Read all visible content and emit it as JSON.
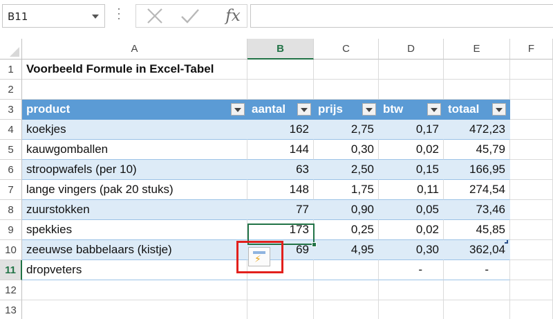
{
  "formula_bar": {
    "name_box": "B11",
    "fx_label": "fx",
    "formula": ""
  },
  "columns": [
    "A",
    "B",
    "C",
    "D",
    "E",
    "F"
  ],
  "active_column": "B",
  "rows": [
    "1",
    "2",
    "3",
    "4",
    "5",
    "6",
    "7",
    "8",
    "9",
    "10",
    "11",
    "12",
    "13"
  ],
  "active_row": "11",
  "title": "Voorbeeld Formule in Excel-Tabel",
  "table": {
    "headers": [
      "product",
      "aantal",
      "prijs",
      "btw",
      "totaal"
    ],
    "data": [
      [
        "koekjes",
        "162",
        "2,75",
        "0,17",
        "472,23"
      ],
      [
        "kauwgomballen",
        "144",
        "0,30",
        "0,02",
        "45,79"
      ],
      [
        "stroopwafels (per 10)",
        "63",
        "2,50",
        "0,15",
        "166,95"
      ],
      [
        "lange vingers (pak 20 stuks)",
        "148",
        "1,75",
        "0,11",
        "274,54"
      ],
      [
        "zuurstokken",
        "77",
        "0,90",
        "0,05",
        "73,46"
      ],
      [
        "spekkies",
        "173",
        "0,25",
        "0,02",
        "45,85"
      ],
      [
        "zeeuwse babbelaars (kistje)",
        "69",
        "4,95",
        "0,30",
        "362,04"
      ],
      [
        "dropveters",
        "",
        "",
        "-",
        "-"
      ]
    ]
  },
  "colors": {
    "header_fill": "#5b9bd5",
    "band_fill": "#ddebf7",
    "selection": "#217346",
    "highlight_box": "#e2201c"
  },
  "icons": {
    "quick_analysis": "quick-analysis-icon",
    "cancel": "cancel-x-icon",
    "confirm": "checkmark-icon"
  }
}
